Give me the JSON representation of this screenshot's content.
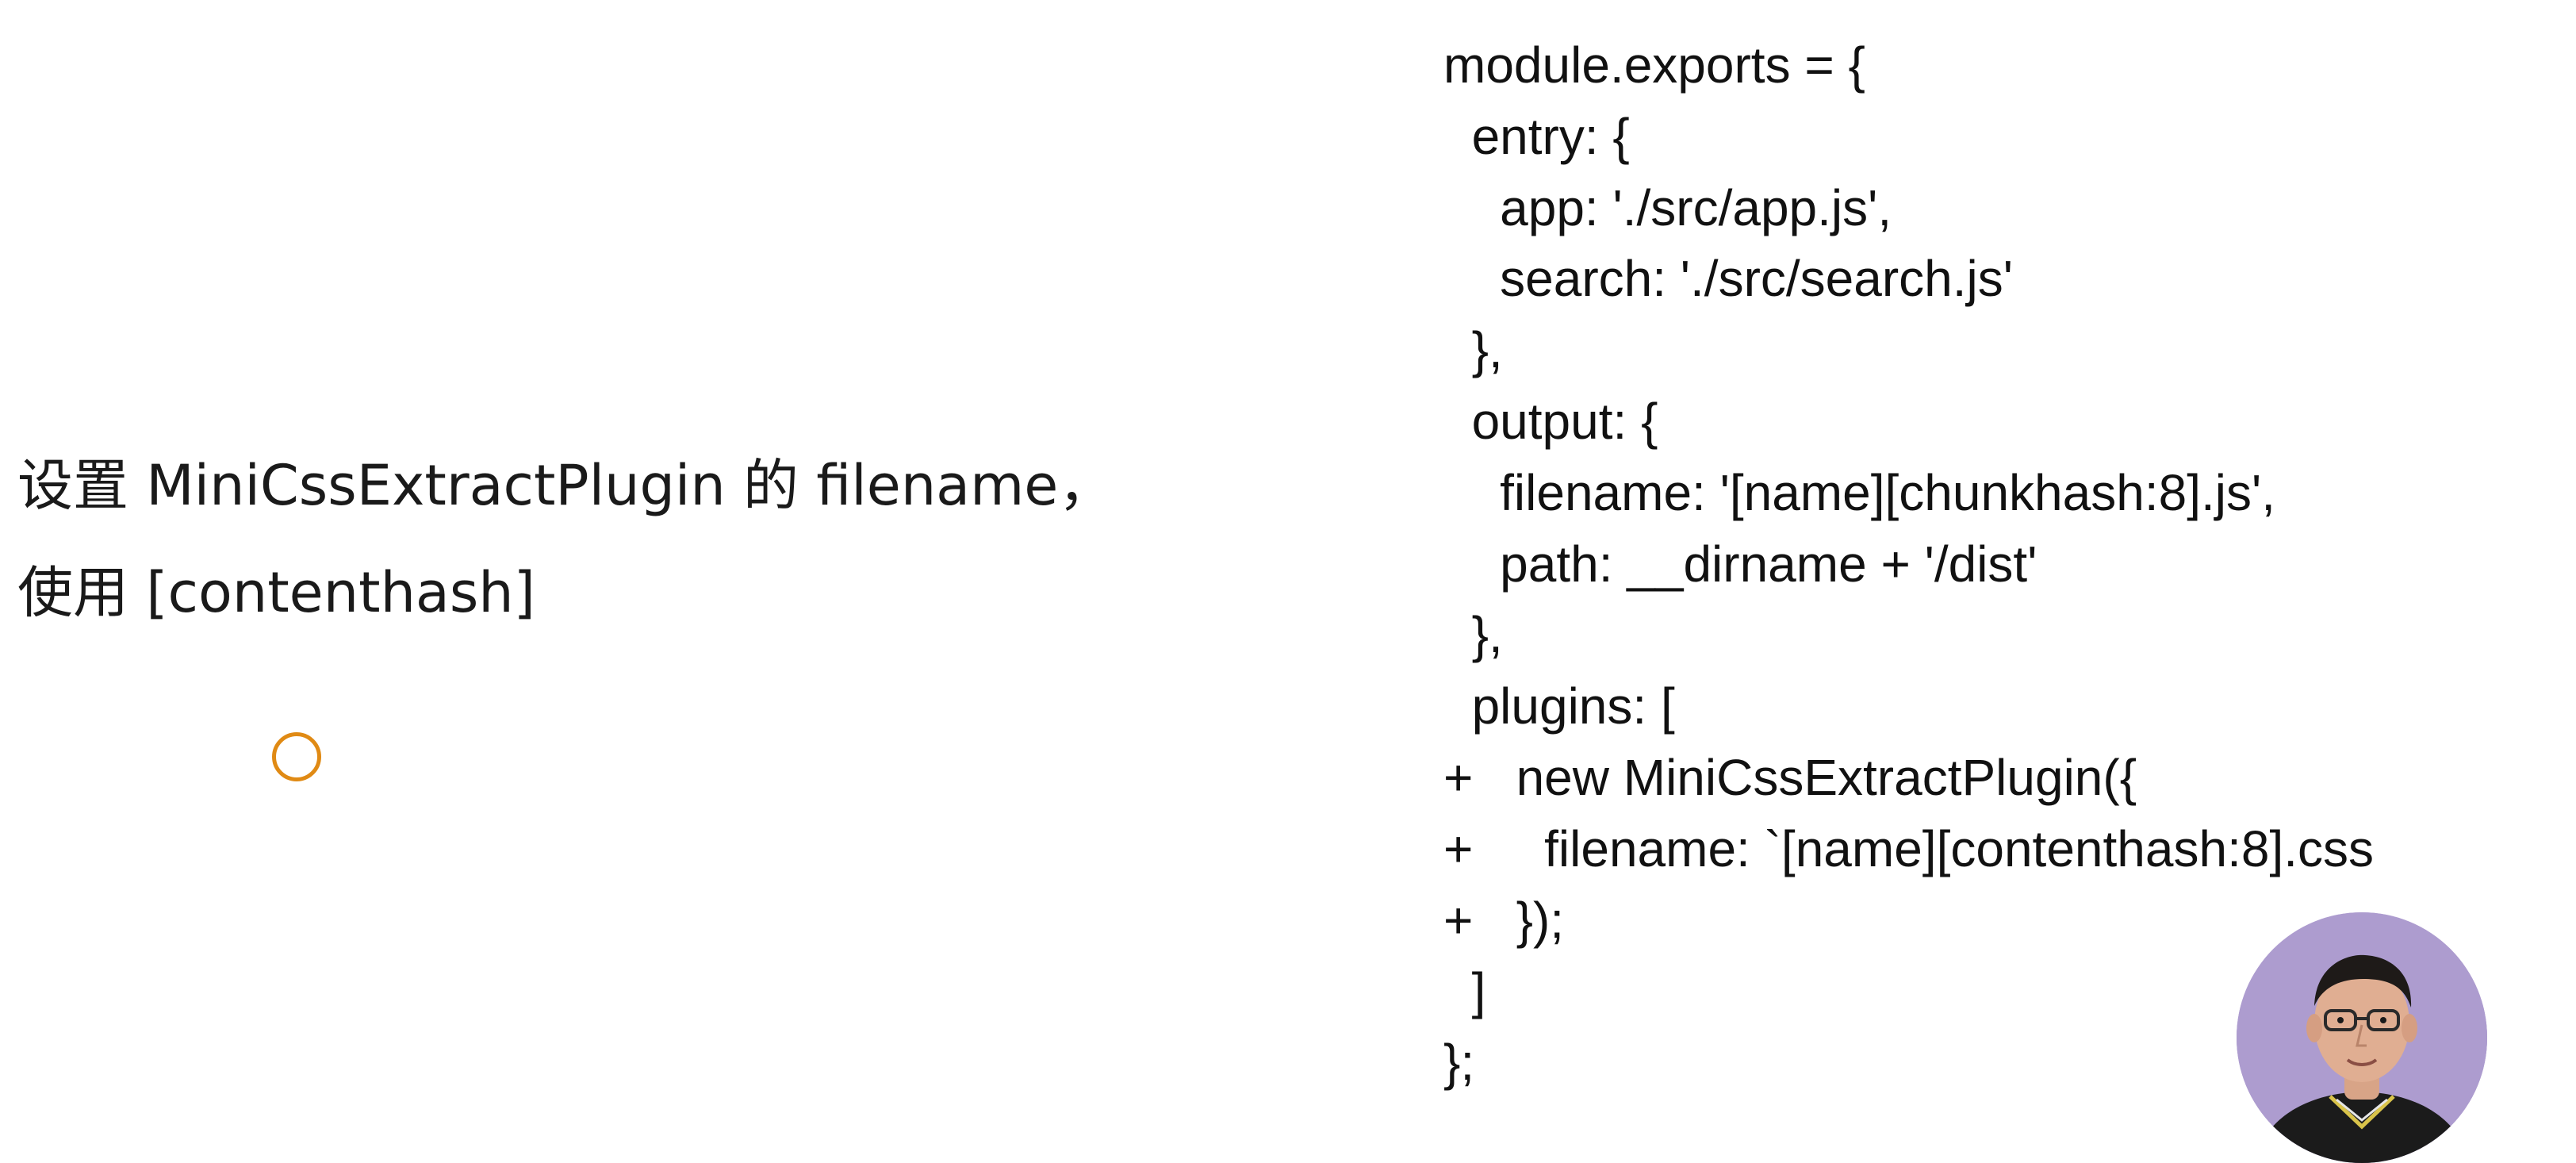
{
  "slide": {
    "left_lines": [
      "设置 MiniCssExtractPlugin 的 filename，",
      "使用 [contenthash]"
    ],
    "code_lines": [
      {
        "marker": "",
        "indent": "",
        "text": "module.exports = {"
      },
      {
        "marker": "",
        "indent": "  ",
        "text": "entry: {"
      },
      {
        "marker": "",
        "indent": "    ",
        "text": "app: './src/app.js',"
      },
      {
        "marker": "",
        "indent": "    ",
        "text": "search: './src/search.js'"
      },
      {
        "marker": "",
        "indent": "  ",
        "text": "},"
      },
      {
        "marker": "",
        "indent": "  ",
        "text": "output: {"
      },
      {
        "marker": "",
        "indent": "    ",
        "text": "filename: '[name][chunkhash:8].js',"
      },
      {
        "marker": "",
        "indent": "    ",
        "text": "path: __dirname + '/dist'"
      },
      {
        "marker": "",
        "indent": "  ",
        "text": "},"
      },
      {
        "marker": "",
        "indent": "  ",
        "text": "plugins: ["
      },
      {
        "marker": "+",
        "indent": "  ",
        "text": "new MiniCssExtractPlugin({"
      },
      {
        "marker": "+",
        "indent": "    ",
        "text": "filename: `[name][contenthash:8].css"
      },
      {
        "marker": "+",
        "indent": "  ",
        "text": "});"
      },
      {
        "marker": "",
        "indent": "  ",
        "text": "]"
      },
      {
        "marker": "",
        "indent": "",
        "text": "};"
      }
    ]
  },
  "colors": {
    "background": "#ffffff",
    "text": "#111111",
    "cursor_ring": "#e08a14",
    "presenter_bg": "#a493c8"
  },
  "icons": {
    "cursor": "cursor-ring-icon",
    "presenter": "presenter-avatar"
  }
}
